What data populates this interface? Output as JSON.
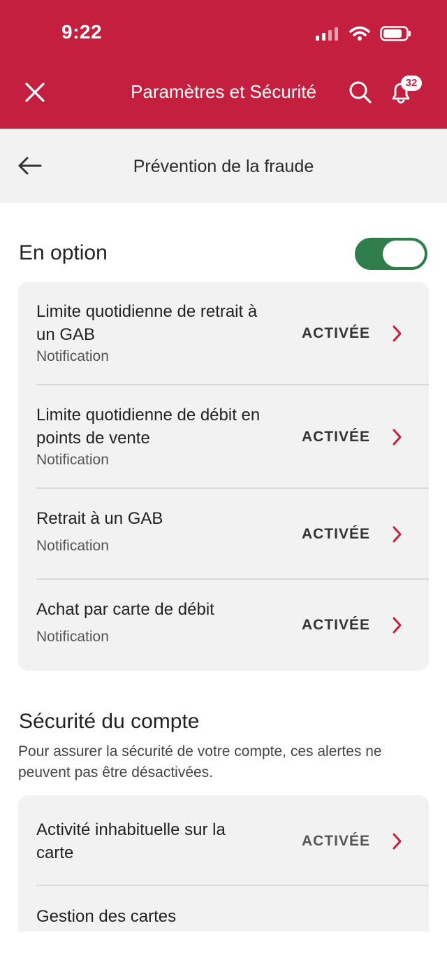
{
  "status_bar": {
    "time": "9:22"
  },
  "header": {
    "title": "Paramètres et Sécurité",
    "notification_count": "32",
    "brand_color": "#c41f3e"
  },
  "subheader": {
    "title": "Prévention de la fraude"
  },
  "optional_section": {
    "heading": "En option",
    "toggle_on": true,
    "toggle_color": "#2f7d4b",
    "items": [
      {
        "title": "Limite quotidienne de retrait à un GAB",
        "subtitle": "Notification",
        "status": "ACTIVÉE"
      },
      {
        "title": "Limite quotidienne de débit en points de vente",
        "subtitle": "Notification",
        "status": "ACTIVÉE"
      },
      {
        "title": "Retrait à un GAB",
        "subtitle": "Notification",
        "status": "ACTIVÉE"
      },
      {
        "title": "Achat par carte de débit",
        "subtitle": "Notification",
        "status": "ACTIVÉE"
      }
    ]
  },
  "security_section": {
    "heading": "Sécurité du compte",
    "description": "Pour assurer la sécurité de votre compte, ces alertes ne peuvent pas être désactivées.",
    "items": [
      {
        "title": "Activité inhabituelle sur la carte",
        "status": "ACTIVÉE"
      },
      {
        "title": "Gestion des cartes"
      }
    ]
  },
  "icons": {
    "close": "close-icon",
    "search": "search-icon",
    "bell": "bell-icon",
    "back": "arrow-left-icon",
    "chevron": "chevron-right-icon"
  }
}
